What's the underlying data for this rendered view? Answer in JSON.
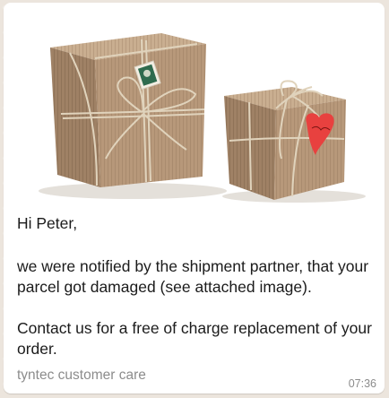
{
  "message": {
    "image_label": "Photo of two kraft-paper wrapped parcels tied with twine",
    "greeting": "Hi Peter,",
    "body_line": "we were notified by the shipment partner, that your parcel got damaged (see attached image).",
    "contact_line": "Contact us for a free of charge replacement of your order.",
    "sender": "tyntec customer care",
    "time": "07:36"
  },
  "colors": {
    "chat_background": "#ece5dd",
    "bubble": "#ffffff",
    "text": "#1b1b1b",
    "meta_text": "#8c8c8c",
    "parcel_paper": "#b89a78",
    "twine": "#d8cbb4",
    "heart_tag": "#e8413f"
  }
}
